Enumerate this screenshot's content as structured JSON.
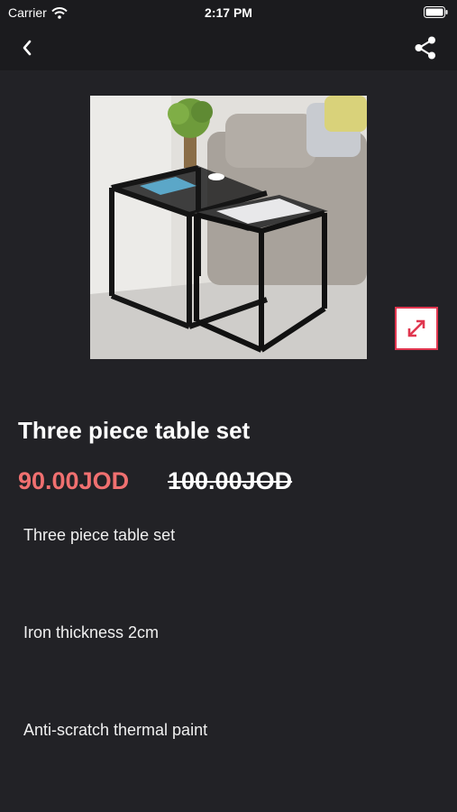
{
  "status_bar": {
    "carrier": "Carrier",
    "time": "2:17 PM"
  },
  "nav": {
    "back_icon": "chevron-left-icon",
    "share_icon": "share-icon"
  },
  "product": {
    "image_alt": "Three piece table set product photo",
    "expand_icon": "expand-arrows-icon",
    "title": "Three piece table set",
    "price": "90.00JOD",
    "old_price": "100.00JOD",
    "description": [
      "Three piece table set",
      "Iron thickness 2cm",
      "Anti-scratch thermal paint"
    ]
  },
  "colors": {
    "background": "#222226",
    "bar": "#1b1b1e",
    "price": "#f07070",
    "accent": "#e0364f"
  }
}
